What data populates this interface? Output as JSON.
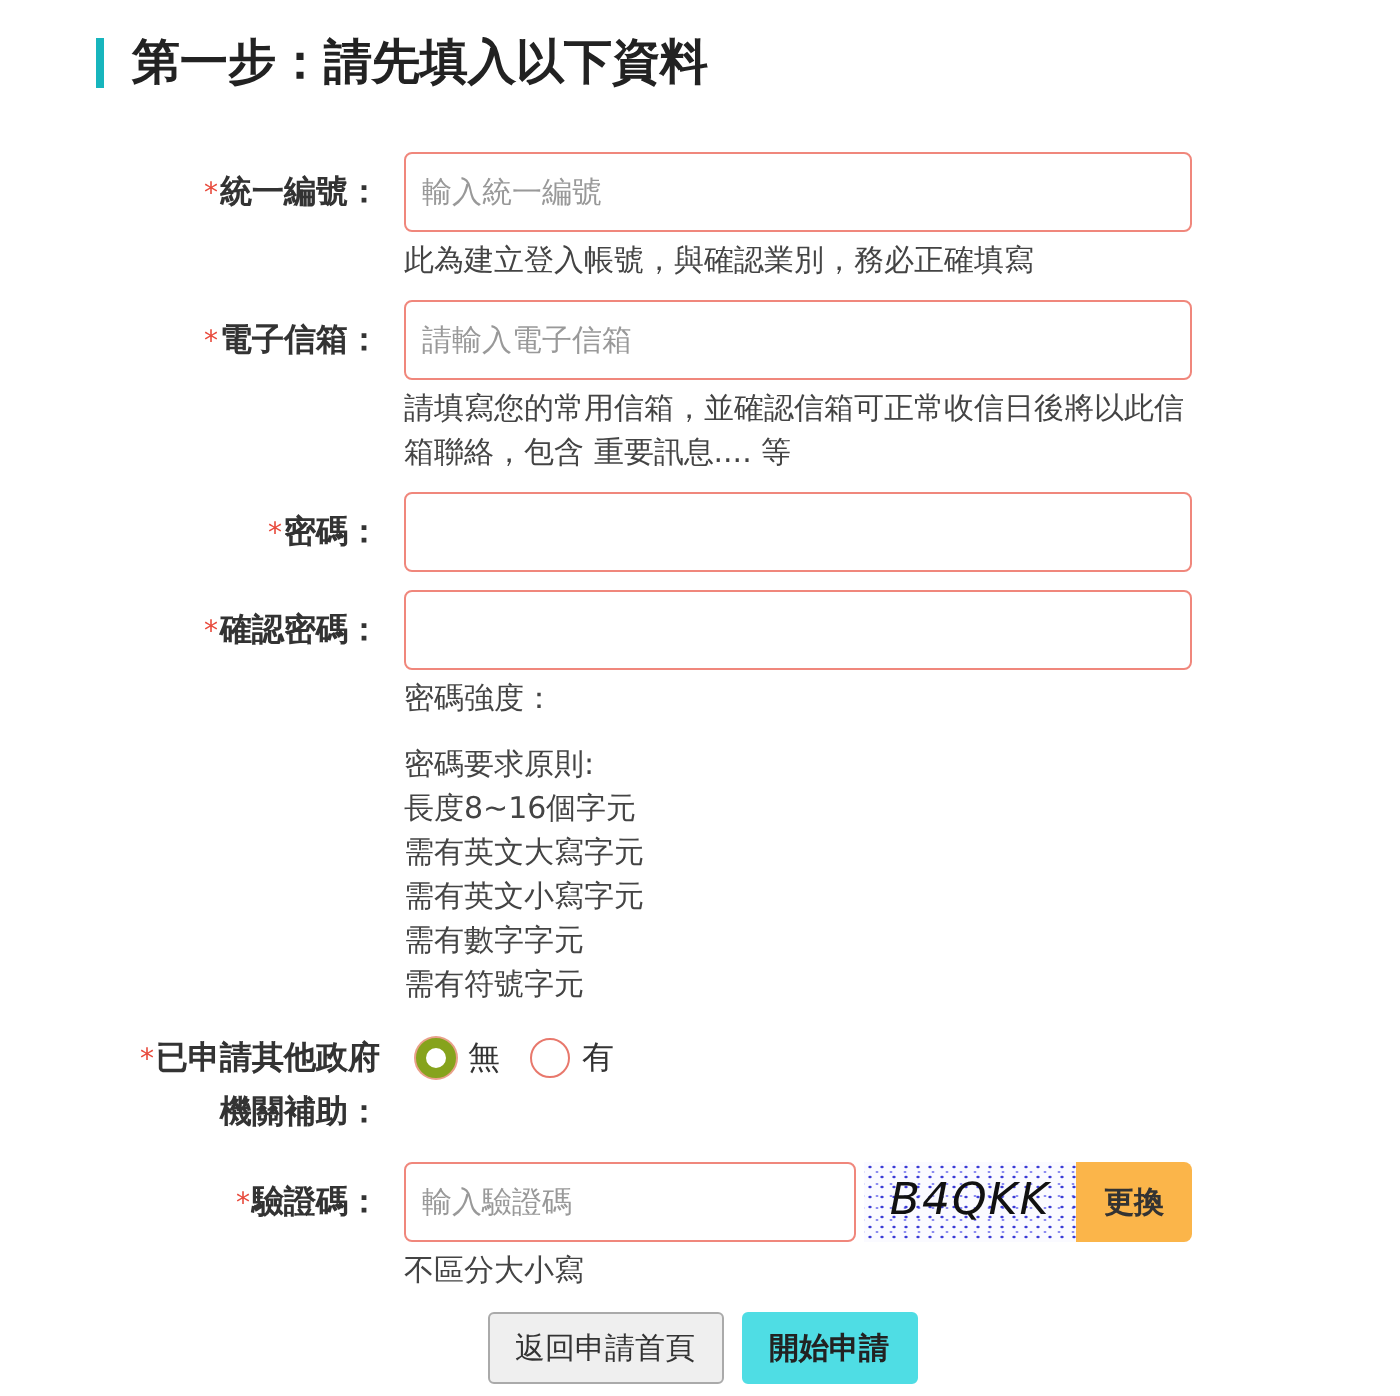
{
  "heading": {
    "title": "第一步：請先填入以下資料"
  },
  "fields": [
    {
      "kind": "text",
      "required_mark": "*",
      "label": "統一編號：",
      "placeholder": "輸入統一編號",
      "hint": "此為建立登入帳號，與確認業別，務必正確填寫"
    },
    {
      "kind": "text",
      "required_mark": "*",
      "label": "電子信箱：",
      "placeholder": "請輸入電子信箱",
      "hint": "請填寫您的常用信箱，並確認信箱可正常收信日後將以此信箱聯絡，包含 重要訊息.... 等"
    },
    {
      "kind": "password",
      "required_mark": "*",
      "label": "密碼："
    },
    {
      "kind": "password",
      "required_mark": "*",
      "label": "確認密碼：",
      "strength_label": "密碼強度：",
      "rules": {
        "title": "密碼要求原則:",
        "items": [
          "長度8~16個字元",
          "需有英文大寫字元",
          "需有英文小寫字元",
          "需有數字字元",
          "需有符號字元"
        ]
      }
    },
    {
      "kind": "radio",
      "required_mark": "*",
      "label": "已申請其他政府機關補助：",
      "options": [
        {
          "label": "無",
          "selected": true
        },
        {
          "label": "有",
          "selected": false
        }
      ]
    },
    {
      "kind": "captcha",
      "required_mark": "*",
      "label": "驗證碼：",
      "placeholder": "輸入驗證碼",
      "captcha_code": "B4QKK",
      "refresh_button": "更換",
      "hint": "不區分大小寫"
    }
  ],
  "buttons": [
    {
      "kind": "secondary",
      "label": "返回申請首頁"
    },
    {
      "kind": "primary",
      "label": "開始申請"
    }
  ]
}
